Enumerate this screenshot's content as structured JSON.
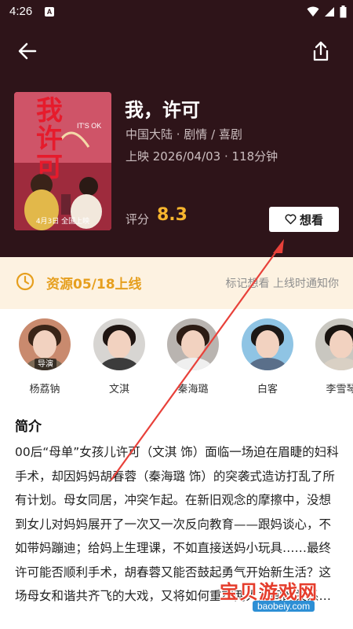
{
  "status_bar": {
    "time": "4:26",
    "badge": "A"
  },
  "movie": {
    "title": "我，许可",
    "meta_line1": "中国大陆 · 剧情 / 喜剧",
    "meta_line2": "上映 2026/04/03 · 118分钟",
    "rating_label": "评分",
    "rating_value": "8.3"
  },
  "poster": {
    "title_chars": "我许可",
    "top_label": "IT'S OK",
    "date_text": "4月3日 全国上映"
  },
  "actions": {
    "want_label": "想看"
  },
  "notice": {
    "main_text": "资源05/18上线",
    "hint_text": "标记想看 上线时通知你"
  },
  "cast": [
    {
      "name": "杨荔钠",
      "role": "导演",
      "hair": "#3a2518",
      "cloth": "#7c6a55"
    },
    {
      "name": "文淇",
      "role": "",
      "hair": "#1f1512",
      "cloth": "#3c3c3c"
    },
    {
      "name": "秦海璐",
      "role": "",
      "hair": "#2c1c14",
      "cloth": "#efefef"
    },
    {
      "name": "白客",
      "role": "",
      "hair": "#1c1816",
      "cloth": "#5a6f8a"
    },
    {
      "name": "李雪琴",
      "role": "",
      "hair": "#191410",
      "cloth": "#d9d0c4"
    }
  ],
  "intro": {
    "title": "简介",
    "body": "00后“母单”女孩儿许可（文淇 饰）面临一场迫在眉睫的妇科手术，却因妈妈胡春蓉（秦海璐 饰）的突袭式造访打乱了所有计划。母女同居，冲突乍起。在新旧观念的摩擦中，没想到女儿对妈妈展开了一次又一次反向教育——跟妈谈心，不如带妈蹦迪；给妈上生理课，不如直接送妈小玩具……最终许可能否顺利手术，胡春蓉又能否鼓起勇气开始新生活？这场母女和谐共齐飞的大戏，又将如何重塑两人之间的关系…"
  },
  "watermark": {
    "text": "宝贝游戏网",
    "url": "baobeiy.com"
  },
  "colors": {
    "header_bg": "#2e1419",
    "accent": "#f7b52e",
    "notice_bg": "#fdf2e1",
    "notice_text": "#e69f1e",
    "arrow": "#e8413a"
  },
  "icons": [
    "back-arrow-icon",
    "share-icon",
    "heart-icon",
    "clock-icon",
    "wifi-icon",
    "signal-icon",
    "battery-icon"
  ]
}
